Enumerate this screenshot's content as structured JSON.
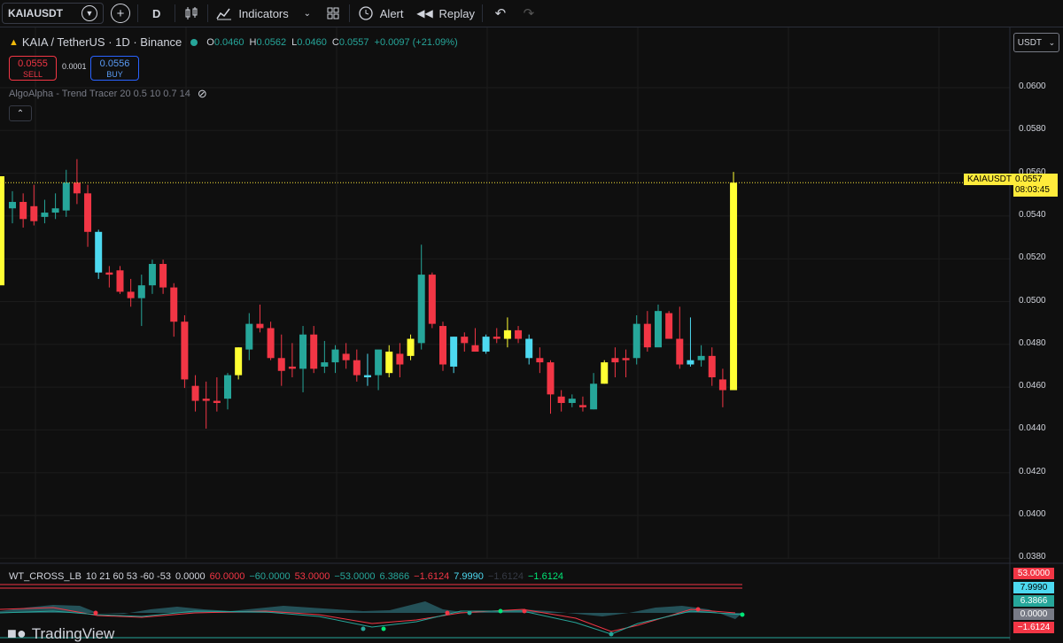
{
  "toolbar": {
    "symbol": "KAIAUSDT",
    "interval": "D",
    "indicators_label": "Indicators",
    "alert_label": "Alert",
    "replay_label": "Replay"
  },
  "legend": {
    "title": "KAIA / TetherUS · 1D · Binance",
    "o_label": "O",
    "o": "0.0460",
    "h_label": "H",
    "h": "0.0562",
    "l_label": "L",
    "l": "0.0460",
    "c_label": "C",
    "c": "0.0557",
    "change": "+0.0097 (+21.09%)"
  },
  "trade": {
    "sell_price": "0.0555",
    "sell_label": "SELL",
    "spread": "0.0001",
    "buy_price": "0.0556",
    "buy_label": "BUY"
  },
  "indicator_label": "AlgoAlpha - Trend Tracer 20 0.5 10 0.7 14",
  "currency": "USDT",
  "price_axis": [
    "0.0600",
    "0.0580",
    "0.0560",
    "0.0540",
    "0.0520",
    "0.0500",
    "0.0480",
    "0.0460",
    "0.0440",
    "0.0420",
    "0.0400",
    "0.0380"
  ],
  "last_price": {
    "symbol": "KAIAUSDT",
    "price": "0.0557",
    "countdown": "08:03:45"
  },
  "wt": {
    "name": "WT_CROSS_LB",
    "params": "10 21 60 53 -60 -53",
    "v0": "0.0000",
    "v60": "60.0000",
    "vm60": "−60.0000",
    "v53": "53.0000",
    "vm53": "−53.0000",
    "v6": "6.3866",
    "vm16": "−1.6124",
    "v79": "7.9990",
    "vm16b": "−1.6124",
    "vm16c": "−1.6124",
    "axis": [
      "53.0000",
      "7.9990",
      "6.3866",
      "0.0000",
      "−1.6124"
    ]
  },
  "brand": "TradingView",
  "colors": {
    "up": "#26a69a",
    "down": "#f23645",
    "yellow": "#ffff33",
    "cyan": "#4dd9f0"
  },
  "chart_data": {
    "type": "candlestick",
    "title": "KAIA / TetherUS · 1D · Binance",
    "ylim": [
      0.0375,
      0.0615
    ],
    "candles": [
      [
        0.0545,
        0.0553,
        0.0538,
        0.0548,
        "up"
      ],
      [
        0.0548,
        0.0552,
        0.0536,
        0.054,
        "down"
      ],
      [
        0.0546,
        0.0556,
        0.0537,
        0.0539,
        "down"
      ],
      [
        0.0541,
        0.0549,
        0.0538,
        0.0543,
        "up"
      ],
      [
        0.0543,
        0.0552,
        0.054,
        0.0545,
        "up"
      ],
      [
        0.0544,
        0.0563,
        0.0541,
        0.0557,
        "up"
      ],
      [
        0.0557,
        0.0568,
        0.0547,
        0.0552,
        "down"
      ],
      [
        0.0552,
        0.0556,
        0.0527,
        0.0534,
        "down"
      ],
      [
        0.0534,
        0.0535,
        0.0512,
        0.0515,
        "cyan"
      ],
      [
        0.0515,
        0.0518,
        0.0508,
        0.0514,
        "down"
      ],
      [
        0.0516,
        0.0518,
        0.0505,
        0.0506,
        "down"
      ],
      [
        0.0506,
        0.0512,
        0.0499,
        0.0503,
        "down"
      ],
      [
        0.0503,
        0.0514,
        0.049,
        0.0509,
        "up"
      ],
      [
        0.0509,
        0.0521,
        0.0505,
        0.0519,
        "up"
      ],
      [
        0.0519,
        0.0521,
        0.0505,
        0.0508,
        "down"
      ],
      [
        0.0508,
        0.051,
        0.0485,
        0.0492,
        "down"
      ],
      [
        0.0492,
        0.0495,
        0.0461,
        0.0465,
        "down"
      ],
      [
        0.0462,
        0.0467,
        0.045,
        0.0455,
        "down"
      ],
      [
        0.0456,
        0.0464,
        0.0442,
        0.0455,
        "down"
      ],
      [
        0.0455,
        0.0466,
        0.045,
        0.0454,
        "down"
      ],
      [
        0.0456,
        0.0468,
        0.0451,
        0.0467,
        "up"
      ],
      [
        0.0467,
        0.048,
        0.0465,
        0.048,
        "yellow"
      ],
      [
        0.0479,
        0.0496,
        0.0474,
        0.0491,
        "up"
      ],
      [
        0.0491,
        0.05,
        0.0487,
        0.0489,
        "down"
      ],
      [
        0.0489,
        0.0492,
        0.0474,
        0.0475,
        "down"
      ],
      [
        0.0475,
        0.0486,
        0.0462,
        0.0469,
        "down"
      ],
      [
        0.0471,
        0.0482,
        0.0466,
        0.047,
        "down"
      ],
      [
        0.047,
        0.049,
        0.0459,
        0.0486,
        "up"
      ],
      [
        0.0486,
        0.049,
        0.0468,
        0.047,
        "down"
      ],
      [
        0.0471,
        0.0483,
        0.0468,
        0.0473,
        "up"
      ],
      [
        0.0473,
        0.0481,
        0.0468,
        0.0479,
        "up"
      ],
      [
        0.0477,
        0.0482,
        0.047,
        0.0474,
        "down"
      ],
      [
        0.0474,
        0.0479,
        0.0464,
        0.0467,
        "down"
      ],
      [
        0.0467,
        0.0477,
        0.0462,
        0.0466,
        "cyan"
      ],
      [
        0.0467,
        0.0476,
        0.046,
        0.0479,
        "up"
      ],
      [
        0.0468,
        0.0481,
        0.0466,
        0.0478,
        "yellow"
      ],
      [
        0.0477,
        0.0482,
        0.0466,
        0.0472,
        "down"
      ],
      [
        0.0476,
        0.0486,
        0.0474,
        0.0484,
        "yellow"
      ],
      [
        0.0482,
        0.0528,
        0.0479,
        0.0514,
        "up"
      ],
      [
        0.0514,
        0.0515,
        0.0489,
        0.0491,
        "down"
      ],
      [
        0.049,
        0.0492,
        0.0469,
        0.0472,
        "down"
      ],
      [
        0.0471,
        0.0485,
        0.0468,
        0.0485,
        "cyan"
      ],
      [
        0.0485,
        0.0487,
        0.0478,
        0.0482,
        "down"
      ],
      [
        0.0481,
        0.0489,
        0.0478,
        0.0478,
        "down"
      ],
      [
        0.0478,
        0.0486,
        0.0477,
        0.0485,
        "cyan"
      ],
      [
        0.0484,
        0.0489,
        0.0482,
        0.0485,
        "down"
      ],
      [
        0.0484,
        0.0494,
        0.048,
        0.0488,
        "yellow"
      ],
      [
        0.0484,
        0.049,
        0.0482,
        0.0488,
        "down"
      ],
      [
        0.0484,
        0.0486,
        0.0472,
        0.0475,
        "cyan"
      ],
      [
        0.0475,
        0.048,
        0.0468,
        0.0473,
        "down"
      ],
      [
        0.0473,
        0.0474,
        0.0449,
        0.0458,
        "down"
      ],
      [
        0.0457,
        0.046,
        0.045,
        0.0454,
        "down"
      ],
      [
        0.0454,
        0.0458,
        0.0452,
        0.0456,
        "up"
      ],
      [
        0.0453,
        0.0457,
        0.045,
        0.0452,
        "down"
      ],
      [
        0.0451,
        0.0468,
        0.0451,
        0.0463,
        "up"
      ],
      [
        0.0463,
        0.0474,
        0.0463,
        0.0473,
        "yellow"
      ],
      [
        0.0473,
        0.048,
        0.0466,
        0.0475,
        "down"
      ],
      [
        0.0474,
        0.0479,
        0.0466,
        0.0475,
        "down"
      ],
      [
        0.0475,
        0.0495,
        0.0472,
        0.0491,
        "up"
      ],
      [
        0.0491,
        0.0497,
        0.0478,
        0.048,
        "down"
      ],
      [
        0.048,
        0.05,
        0.0482,
        0.0497,
        "up"
      ],
      [
        0.0496,
        0.0497,
        0.0484,
        0.0484,
        "down"
      ],
      [
        0.0484,
        0.0499,
        0.047,
        0.0472,
        "down"
      ],
      [
        0.0472,
        0.0494,
        0.0471,
        0.0474,
        "cyan"
      ],
      [
        0.0474,
        0.0481,
        0.0471,
        0.0476,
        "up"
      ],
      [
        0.0476,
        0.048,
        0.0462,
        0.0466,
        "down"
      ],
      [
        0.0465,
        0.047,
        0.0452,
        0.046,
        "down"
      ],
      [
        0.046,
        0.0562,
        0.046,
        0.0557,
        "yellow"
      ]
    ]
  }
}
